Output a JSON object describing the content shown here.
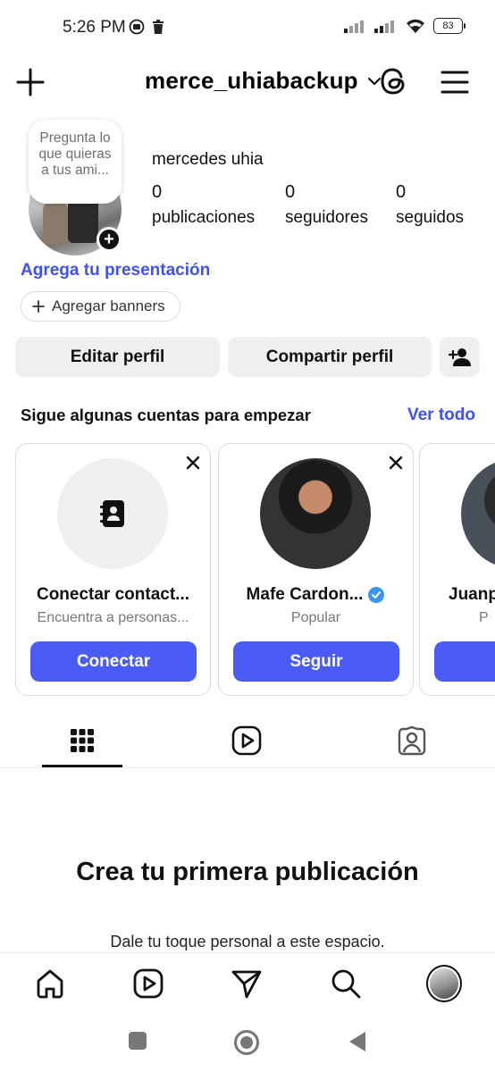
{
  "status_bar": {
    "time": "5:26 PM",
    "battery": "83"
  },
  "header": {
    "username": "merce_uhiabackup"
  },
  "profile": {
    "note": "Pregunta lo que quieras a tus ami...",
    "display_name": "mercedes uhia",
    "stats": [
      {
        "value": "0",
        "label": "publicaciones"
      },
      {
        "value": "0",
        "label": "seguidores"
      },
      {
        "value": "0",
        "label": "seguidos"
      }
    ],
    "bio_link": "Agrega tu presentación",
    "banner_chip": "Agregar banners"
  },
  "actions": {
    "edit": "Editar perfil",
    "share": "Compartir perfil"
  },
  "suggestions": {
    "title": "Sigue algunas cuentas para empezar",
    "see_all": "Ver todo",
    "cards": [
      {
        "name": "Conectar contact...",
        "subtitle": "Encuentra a personas...",
        "button": "Conectar"
      },
      {
        "name": "Mafe Cardon...",
        "subtitle": "Popular",
        "button": "Seguir"
      },
      {
        "name": "Juanp",
        "subtitle": "P",
        "button": "S"
      }
    ]
  },
  "empty_state": {
    "title": "Crea tu primera publicación",
    "subtitle": "Dale tu toque personal a este espacio."
  },
  "colors": {
    "accent": "#4a5cf5",
    "link": "#4150f7",
    "verified": "#3897f0"
  }
}
